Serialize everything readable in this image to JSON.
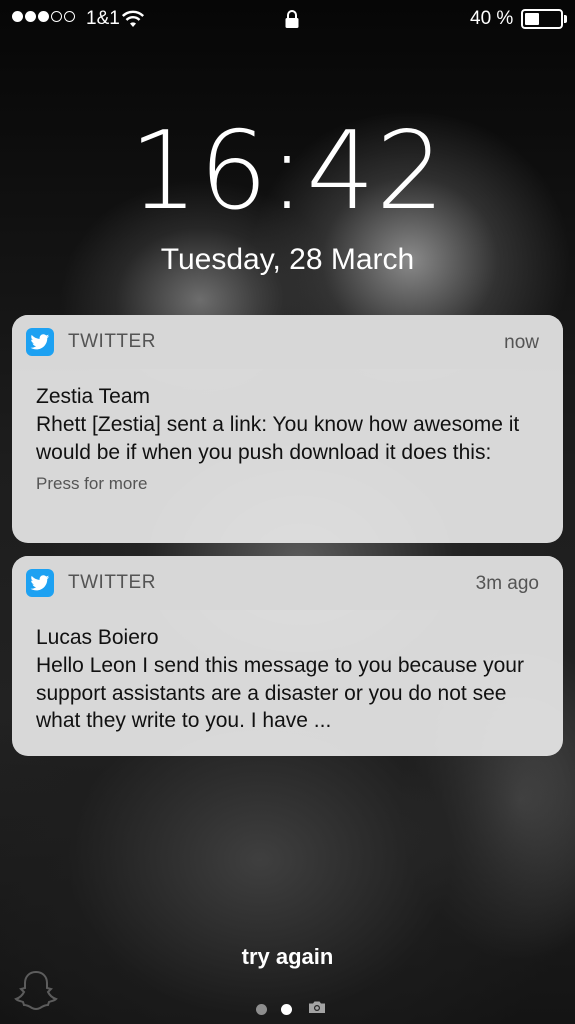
{
  "status_bar": {
    "signal_full": 3,
    "signal_empty": 2,
    "carrier": "1&1",
    "battery_percent_label": "40 %",
    "battery_level": 0.4
  },
  "lock_screen": {
    "time": "16:42",
    "date": "Tuesday, 28 March"
  },
  "notifications": [
    {
      "app": "TWITTER",
      "time": "now",
      "title": "Zestia Team",
      "text": "Rhett [Zestia] sent a link: You know how awesome it would be if when you push download it does this:",
      "hint": "Press for more"
    },
    {
      "app": "TWITTER",
      "time": "3m ago",
      "title": "Lucas Boiero",
      "text": "Hello Leon I send this message to you because your support assistants are a disaster or you do not see what they write to you. I have ..."
    }
  ],
  "bottom": {
    "message": "try again",
    "pages": [
      "page-dot",
      "page-dot-active",
      "camera-icon"
    ]
  },
  "colors": {
    "twitter_blue": "#1da1f2",
    "card_bg": "#e8e8e8",
    "header_bg": "#d6d6d6"
  }
}
